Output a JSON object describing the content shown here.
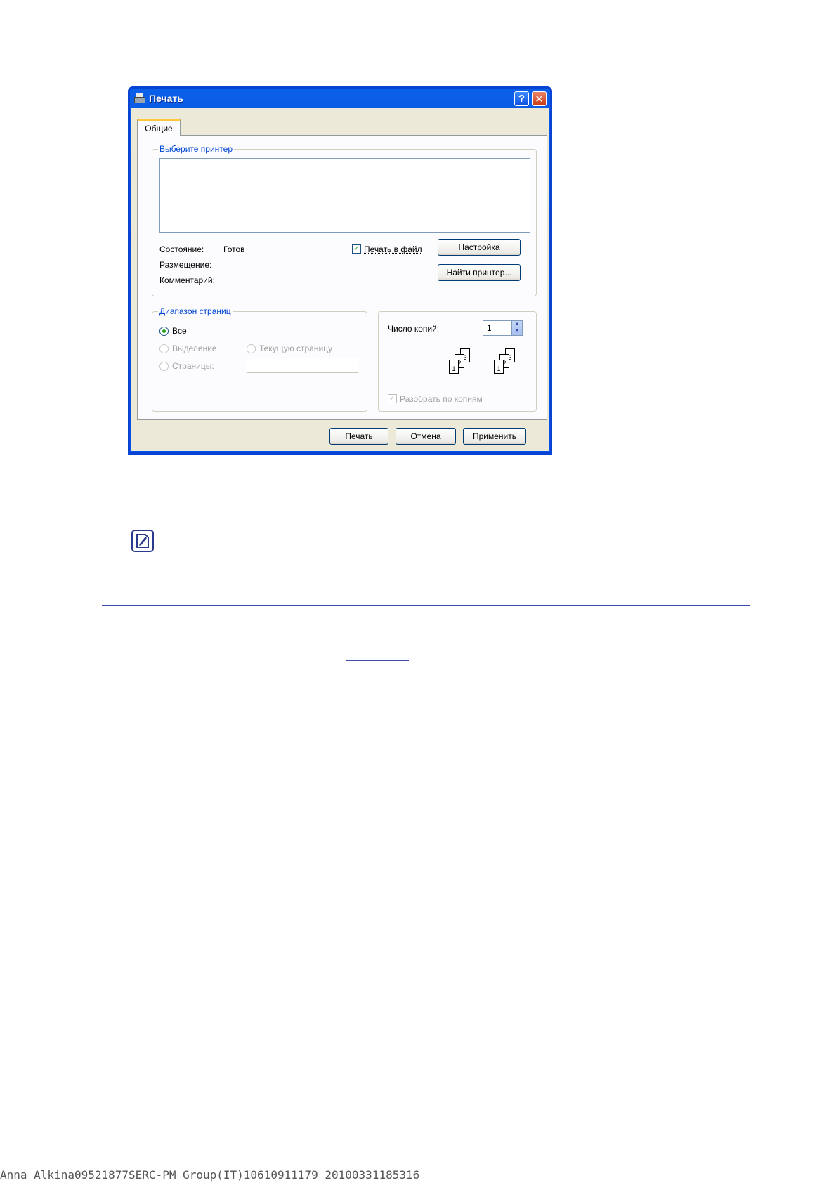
{
  "dialog": {
    "title": "Печать",
    "help_button": "?",
    "close_button": "✕",
    "tabs": [
      {
        "label": "Общие"
      }
    ],
    "printer_group": {
      "legend": "Выберите принтер",
      "status_label": "Состояние:",
      "status_value": "Готов",
      "location_label": "Размещение:",
      "location_value": "",
      "comment_label": "Комментарий:",
      "comment_value": "",
      "print_to_file": {
        "label": "Печать в файл",
        "checked": true
      },
      "preferences_button": "Настройка",
      "find_printer_button": "Найти принтер..."
    },
    "page_range": {
      "legend": "Диапазон страниц",
      "all": "Все",
      "selection": "Выделение",
      "current_page": "Текущую страницу",
      "pages": "Страницы:",
      "pages_value": ""
    },
    "copies": {
      "label": "Число копий:",
      "value": "1",
      "collate": {
        "label": "Разобрать по копиям",
        "checked": true,
        "enabled": false
      },
      "collate_icon_pages": [
        "1",
        "2",
        "3"
      ]
    },
    "buttons": {
      "print": "Печать",
      "cancel": "Отмена",
      "apply": "Применить"
    }
  },
  "footer": {
    "text": "Anna Alkina09521877SERC-PM Group(IT)10610911179 20100331185316"
  },
  "colors": {
    "titlebar": "#0554e6",
    "dialog_bg": "#ece9d8",
    "accent_legend": "#0046d5",
    "rule": "#3b4ba8"
  }
}
